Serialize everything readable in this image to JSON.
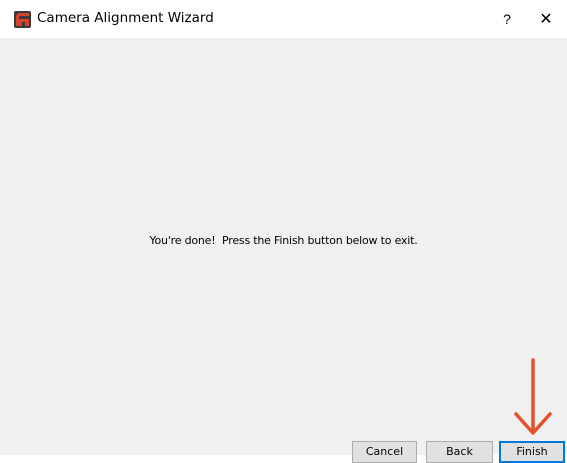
{
  "window": {
    "title": "Camera Alignment Wizard",
    "help_label": "?",
    "close_label": "✕"
  },
  "content": {
    "message": "You're done!  Press the Finish button below to exit."
  },
  "buttons": {
    "cancel_label": "Cancel",
    "back_label": "Back",
    "finish_label": "Finish"
  },
  "colors": {
    "accent": "#0078d7",
    "annotation_arrow": "#e2512d",
    "app_icon": "#c0392b"
  },
  "icons": {
    "app": "camera-alignment-app-icon",
    "help": "question-mark-icon",
    "close": "close-icon",
    "annotation": "down-arrow-annotation-icon"
  }
}
